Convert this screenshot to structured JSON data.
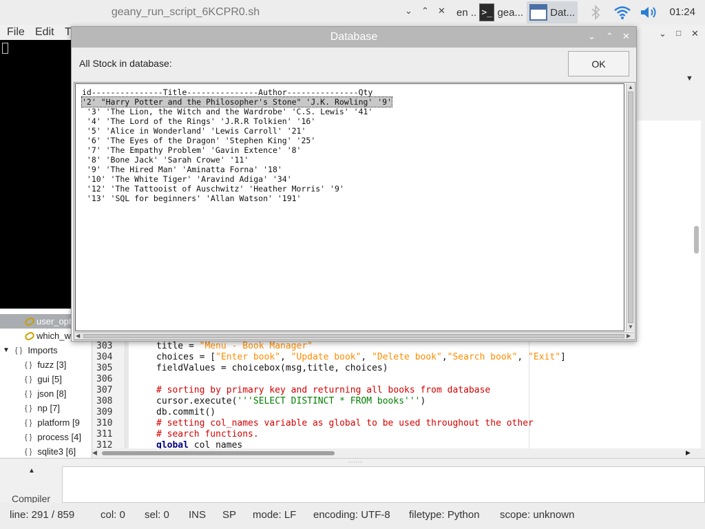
{
  "geany": {
    "title": "geany_run_script_6KCPR0.sh",
    "menu": [
      "File",
      "Edit",
      "T"
    ],
    "sidebar": [
      {
        "label": "user_opt",
        "kind": "key",
        "selected": true
      },
      {
        "label": "which_w",
        "kind": "key",
        "selected": false
      },
      {
        "label": "Imports",
        "kind": "group",
        "selected": false
      },
      {
        "label": "fuzz [3]",
        "kind": "paren",
        "selected": false
      },
      {
        "label": "gui [5]",
        "kind": "paren",
        "selected": false
      },
      {
        "label": "json [8]",
        "kind": "paren",
        "selected": false
      },
      {
        "label": "np [7]",
        "kind": "paren",
        "selected": false
      },
      {
        "label": "platform [9",
        "kind": "paren",
        "selected": false
      },
      {
        "label": "process [4]",
        "kind": "paren",
        "selected": false
      },
      {
        "label": "sqlite3 [6]",
        "kind": "paren",
        "selected": false
      }
    ],
    "code_lines": [
      {
        "n": "303",
        "html": "title = <span class=\"str\">\"Menu - Book Manager\"</span>"
      },
      {
        "n": "304",
        "html": "choices = [<span class=\"str\">\"Enter book\"</span>, <span class=\"str\">\"Update book\"</span>, <span class=\"str\">\"Delete book\"</span>,<span class=\"str\">\"Search book\"</span>, <span class=\"str\">\"Exit\"</span>]"
      },
      {
        "n": "305",
        "html": "fieldValues = choicebox(msg,title, choices)"
      },
      {
        "n": "306",
        "html": ""
      },
      {
        "n": "307",
        "html": "<span class=\"cmt\"># sorting by primary key and returning all books from database</span>"
      },
      {
        "n": "308",
        "html": "cursor.execute(<span class=\"str\" style=\"color:#008000\">'''SELECT DISTINCT * FROM books'''</span>)"
      },
      {
        "n": "309",
        "html": "db.commit()"
      },
      {
        "n": "310",
        "html": "<span class=\"cmt\"># setting col_names variable as global to be used throughout the other</span>"
      },
      {
        "n": "311",
        "html": "<span class=\"cmt\"># search functions.</span>"
      },
      {
        "n": "312",
        "html": "<span class=\"kw\">global</span> col_names"
      }
    ],
    "compiler_tab": "Compiler",
    "status": {
      "line": "line: 291 / 859",
      "col": "col: 0",
      "sel": "sel: 0",
      "ins": "INS",
      "sp": "SP",
      "mode": "mode: LF",
      "encoding": "encoding: UTF-8",
      "filetype": "filetype: Python",
      "scope": "scope: unknown"
    }
  },
  "taskbar": {
    "items": [
      {
        "label": "en ...",
        "icon": "none"
      },
      {
        "label": "gea...",
        "icon": "terminal-icon"
      },
      {
        "label": "Dat...",
        "icon": "window-icon"
      }
    ],
    "clock": "01:24"
  },
  "dialog": {
    "title": "Database",
    "message": "All Stock in database:",
    "ok_label": "OK",
    "rows": [
      "id---------------Title---------------Author---------------Qty",
      "'2' \"Harry Potter and the Philosopher's Stone\" 'J.K. Rowling' '9'",
      " '3' 'The Lion, the Witch and the Wardrobe' 'C.S. Lewis' '41'",
      " '4' 'The Lord of the Rings' 'J.R.R Tolkien' '16'",
      " '5' 'Alice in Wonderland' 'Lewis Carroll' '21'",
      " '6' 'The Eyes of the Dragon' 'Stephen King' '25'",
      " '7' 'The Empathy Problem' 'Gavin Extence' '8'",
      " '8' 'Bone Jack' 'Sarah Crowe' '11'",
      " '9' 'The Hired Man' 'Aminatta Forna' '18'",
      " '10' 'The White Tiger' 'Aravind Adiga' '34'",
      " '12' 'The Tattooist of Auschwitz' 'Heather Morris' '9'",
      " '13' 'SQL for beginners' 'Allan Watson' '191'"
    ],
    "selected_row": 1
  }
}
